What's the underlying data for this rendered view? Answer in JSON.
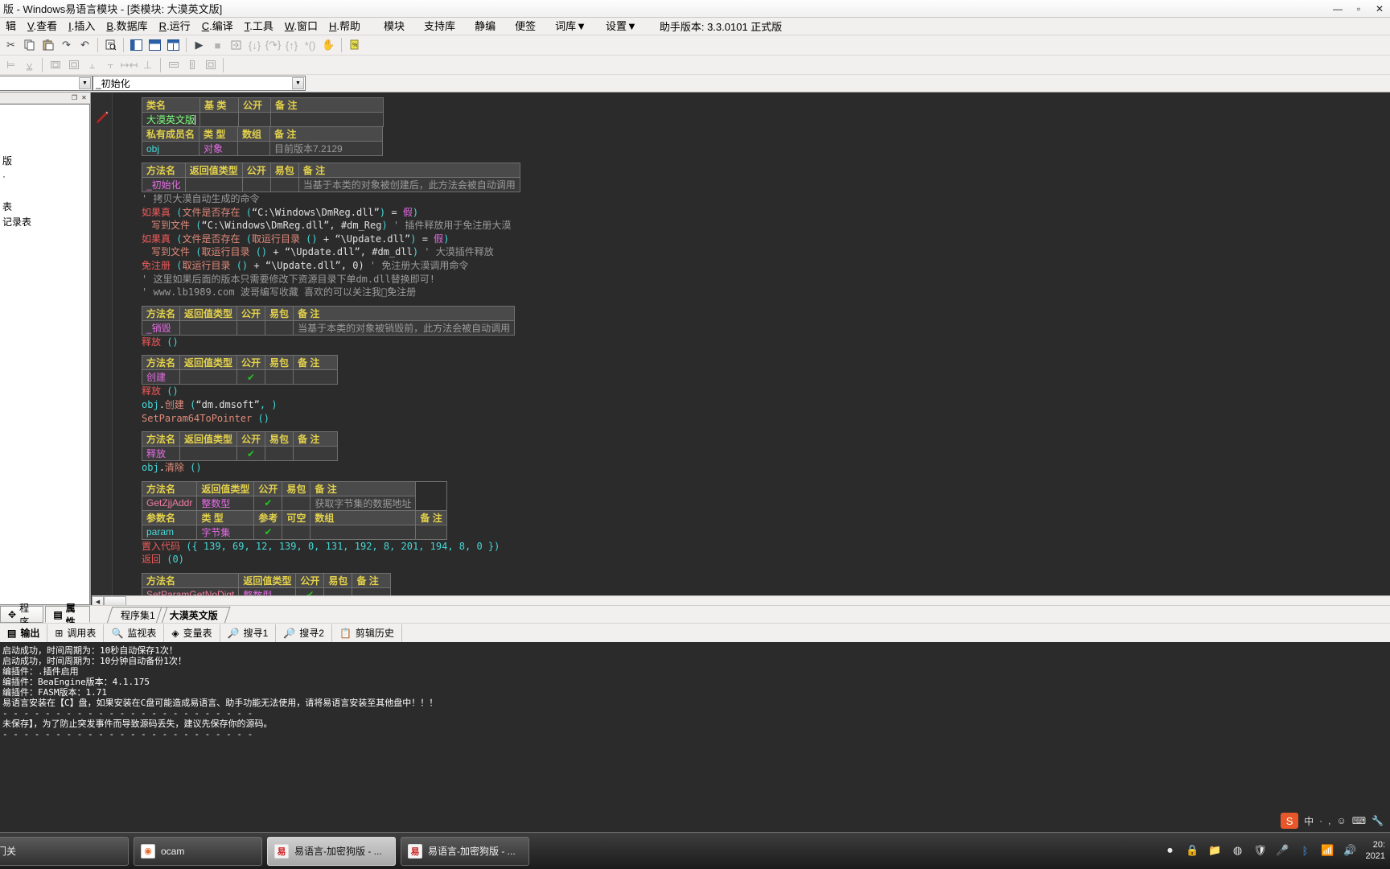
{
  "window": {
    "title": "版 - Windows易语言模块 - [类模块: 大漠英文版]",
    "minimize": "—",
    "maximize": "▫",
    "close": "✕"
  },
  "menubar": {
    "items": [
      {
        "mnemonic": "",
        "label": "辑"
      },
      {
        "mnemonic": "V",
        "label": ".查看"
      },
      {
        "mnemonic": "I",
        "label": ".插入"
      },
      {
        "mnemonic": "B",
        "label": ".数据库"
      },
      {
        "mnemonic": "R",
        "label": ".运行"
      },
      {
        "mnemonic": "C",
        "label": ".编译"
      },
      {
        "mnemonic": "T",
        "label": ".工具"
      },
      {
        "mnemonic": "W",
        "label": ".窗口"
      },
      {
        "mnemonic": "H",
        "label": ".帮助"
      }
    ],
    "extra": [
      "模块",
      "支持库",
      "静编",
      "便签",
      "词库▼",
      "设置▼"
    ],
    "assistant_version": "助手版本: 3.3.0101 正式版"
  },
  "toolbar1": {
    "icons": [
      "cut-icon",
      "copy-icon",
      "paste-icon",
      "redo-icon",
      "undo-icon",
      "find-icon",
      "layout-left-icon",
      "layout-top-icon",
      "layout-grid-icon",
      "run-icon",
      "stop-icon",
      "compile-icon",
      "step-into-icon",
      "step-over-icon",
      "step-out-icon",
      "run-to-cursor-icon",
      "hand-icon",
      "bookmark-icon"
    ]
  },
  "toolbar2": {
    "icons": [
      "align-left-icon",
      "align-center-icon",
      "align-grid-h-icon",
      "align-grid-v-icon",
      "align-top-icon",
      "align-bottom-icon",
      "space-h-icon",
      "space-v-icon",
      "size-width-icon",
      "size-height-icon",
      "size-both-icon"
    ]
  },
  "combos": {
    "left_value": "",
    "right_value": "_初始化"
  },
  "left_panel": {
    "caption_buttons": [
      "restore-icon",
      "close-icon"
    ],
    "lines": [
      "",
      "",
      "",
      "版",
      "·",
      "",
      "表",
      "记录表"
    ]
  },
  "editor": {
    "class_table": {
      "headers": [
        "类名",
        "基 类",
        "公开",
        "备 注"
      ],
      "rows": [
        [
          "大漠英文版",
          "",
          "",
          ""
        ]
      ]
    },
    "member_table": {
      "headers": [
        "私有成员名",
        "类 型",
        "数组",
        "备 注"
      ],
      "rows": [
        [
          "obj",
          "对象",
          "",
          "目前版本7.2129"
        ]
      ]
    },
    "method_init": {
      "headers": [
        "方法名",
        "返回值类型",
        "公开",
        "易包",
        "备 注"
      ],
      "rows": [
        [
          "_初始化",
          "",
          "",
          "",
          "当基于本类的对象被创建后，此方法会被自动调用"
        ]
      ]
    },
    "init_code": [
      {
        "indent": 0,
        "parts": [
          {
            "t": "'  拷贝大漠自动生成的命令",
            "c": "c-gray"
          }
        ]
      },
      {
        "indent": 0,
        "parts": [
          {
            "t": "如果真",
            "c": "c-kw"
          },
          {
            "t": " (",
            "c": "c-cyan"
          },
          {
            "t": "文件是否存在",
            "c": "c-salmon"
          },
          {
            "t": " (",
            "c": "c-cyan"
          },
          {
            "t": "“C:\\Windows\\DmReg.dll”",
            "c": "c-white"
          },
          {
            "t": ")",
            "c": "c-cyan"
          },
          {
            "t": " = ",
            "c": "c-white"
          },
          {
            "t": "假",
            "c": "c-magenta"
          },
          {
            "t": ")",
            "c": "c-cyan"
          }
        ]
      },
      {
        "indent": 1,
        "parts": [
          {
            "t": "写到文件",
            "c": "c-salmon"
          },
          {
            "t": " (",
            "c": "c-cyan"
          },
          {
            "t": "“C:\\Windows\\DmReg.dll”",
            "c": "c-white"
          },
          {
            "t": ", ",
            "c": "c-white"
          },
          {
            "t": "#dm_Reg",
            "c": "c-white"
          },
          {
            "t": ")",
            "c": "c-cyan"
          },
          {
            "t": "   '  插件释放用于免注册大漠",
            "c": "c-gray"
          }
        ]
      },
      {
        "indent": 0,
        "parts": [
          {
            "t": "如果真",
            "c": "c-kw"
          },
          {
            "t": " (",
            "c": "c-cyan"
          },
          {
            "t": "文件是否存在",
            "c": "c-salmon"
          },
          {
            "t": " (",
            "c": "c-cyan"
          },
          {
            "t": "取运行目录",
            "c": "c-salmon"
          },
          {
            "t": " ()",
            "c": "c-cyan"
          },
          {
            "t": " + ",
            "c": "c-white"
          },
          {
            "t": "“\\Update.dll”",
            "c": "c-white"
          },
          {
            "t": ")",
            "c": "c-cyan"
          },
          {
            "t": " = ",
            "c": "c-white"
          },
          {
            "t": "假",
            "c": "c-magenta"
          },
          {
            "t": ")",
            "c": "c-cyan"
          }
        ]
      },
      {
        "indent": 1,
        "parts": [
          {
            "t": "写到文件",
            "c": "c-salmon"
          },
          {
            "t": " (",
            "c": "c-cyan"
          },
          {
            "t": "取运行目录",
            "c": "c-salmon"
          },
          {
            "t": " ()",
            "c": "c-cyan"
          },
          {
            "t": " + ",
            "c": "c-white"
          },
          {
            "t": "“\\Update.dll”",
            "c": "c-white"
          },
          {
            "t": ", ",
            "c": "c-white"
          },
          {
            "t": "#dm_dll",
            "c": "c-white"
          },
          {
            "t": ")",
            "c": "c-cyan"
          },
          {
            "t": "   '  大漠插件释放",
            "c": "c-gray"
          }
        ]
      },
      {
        "indent": 0,
        "parts": [
          {
            "t": "免注册",
            "c": "c-kw"
          },
          {
            "t": " (",
            "c": "c-cyan"
          },
          {
            "t": "取运行目录",
            "c": "c-salmon"
          },
          {
            "t": " ()",
            "c": "c-cyan"
          },
          {
            "t": " + ",
            "c": "c-white"
          },
          {
            "t": "“\\Update.dll”",
            "c": "c-white"
          },
          {
            "t": ", 0)",
            "c": "c-white"
          },
          {
            "t": "   '  免注册大漠调用命令",
            "c": "c-gray"
          }
        ]
      },
      {
        "indent": 0,
        "parts": [
          {
            "t": "'  这里如果后面的版本只需要修改下资源目录下单dm.dll替换即可!",
            "c": "c-gray"
          }
        ]
      },
      {
        "indent": 0,
        "parts": [
          {
            "t": "'  www.lb1989.com 波哥编写收藏 喜欢的可以关注我哟̈免注册",
            "c": "c-gray"
          }
        ]
      }
    ],
    "method_destroy": {
      "headers": [
        "方法名",
        "返回值类型",
        "公开",
        "易包",
        "备 注"
      ],
      "rows": [
        [
          "_销毁",
          "",
          "",
          "",
          "当基于本类的对象被销毁前，此方法会被自动调用"
        ]
      ]
    },
    "destroy_code": [
      {
        "t": "释放",
        "c": "c-kw"
      },
      {
        "t": " ()",
        "c": "c-cyan"
      }
    ],
    "method_create": {
      "headers": [
        "方法名",
        "返回值类型",
        "公开",
        "易包",
        "备 注"
      ],
      "rows": [
        [
          "创建",
          "",
          "✔",
          "",
          ""
        ]
      ]
    },
    "create_code": [
      [
        {
          "t": "释放",
          "c": "c-kw"
        },
        {
          "t": " ()",
          "c": "c-cyan"
        }
      ],
      [
        {
          "t": "obj",
          "c": "c-cyan"
        },
        {
          "t": ".",
          "c": "c-white"
        },
        {
          "t": "创建",
          "c": "c-salmon"
        },
        {
          "t": " (",
          "c": "c-cyan"
        },
        {
          "t": "“dm.dmsoft”",
          "c": "c-white"
        },
        {
          "t": ", )",
          "c": "c-cyan"
        }
      ],
      [
        {
          "t": "SetParam64ToPointer",
          "c": "c-salmon"
        },
        {
          "t": " ()",
          "c": "c-cyan"
        }
      ]
    ],
    "method_release": {
      "headers": [
        "方法名",
        "返回值类型",
        "公开",
        "易包",
        "备 注"
      ],
      "rows": [
        [
          "释放",
          "",
          "✔",
          "",
          ""
        ]
      ]
    },
    "release_code": [
      [
        {
          "t": "obj",
          "c": "c-cyan"
        },
        {
          "t": ".",
          "c": "c-white"
        },
        {
          "t": "清除",
          "c": "c-salmon"
        },
        {
          "t": " ()",
          "c": "c-cyan"
        }
      ]
    ],
    "method_getzjj": {
      "headers": [
        "方法名",
        "返回值类型",
        "公开",
        "易包",
        "备 注"
      ],
      "rows": [
        [
          "GetZjjAddr",
          "整数型",
          "✔",
          "",
          "获取字节集的数据地址"
        ]
      ],
      "param_headers": [
        "参数名",
        "类 型",
        "参考",
        "可空",
        "数组",
        "备 注"
      ],
      "param_rows": [
        [
          "param",
          "字节集",
          "✔",
          "",
          "",
          ""
        ]
      ]
    },
    "getzjj_code": [
      [
        {
          "t": "置入代码",
          "c": "c-kw"
        },
        {
          "t": " ({ 139, 69, 12, 139, 0, 131, 192, 8, 201, 194, 8, 0 })",
          "c": "c-cyan"
        }
      ],
      [
        {
          "t": "返回",
          "c": "c-kw"
        },
        {
          "t": " (0)",
          "c": "c-cyan"
        }
      ]
    ],
    "method_last": {
      "headers": [
        "方法名",
        "返回值类型",
        "公开",
        "易包",
        "备 注"
      ],
      "rows": [
        [
          "SetParamGetNoDigt",
          "整数型",
          "✔",
          "",
          ""
        ]
      ]
    }
  },
  "bottom_tabs": {
    "panel_tabs": [
      {
        "icon": "program-icon",
        "label": "程序"
      },
      {
        "icon": "properties-icon",
        "label": "属性"
      }
    ],
    "sheet_tabs": [
      {
        "label": "程序集1",
        "active": false
      },
      {
        "label": "大漠英文版",
        "active": true
      }
    ]
  },
  "output_toolbar": {
    "buttons": [
      {
        "icon": "output-icon",
        "label": "输出"
      },
      {
        "icon": "calltable-icon",
        "label": "调用表"
      },
      {
        "icon": "watch-icon",
        "label": "监视表"
      },
      {
        "icon": "variable-icon",
        "label": "变量表"
      },
      {
        "icon": "search1-icon",
        "label": "搜寻1"
      },
      {
        "icon": "search2-icon",
        "label": "搜寻2"
      },
      {
        "icon": "clipboard-history-icon",
        "label": "剪辑历史"
      }
    ]
  },
  "console": {
    "lines": [
      "启动成功，时间周期为：10秒自动保存1次！",
      "启动成功，时间周期为：10分钟自动备份1次！",
      "编插件：.插件启用",
      "编插件：BeaEngine版本：4.1.175",
      "编插件：FASM版本：1.71",
      "易语言安装在【C】盘，如果安装在C盘可能造成易语言、助手功能无法使用，请将易语言安装至其他盘中！！！",
      "- - - - - - - - - - - - - - - - - - - - - - - -",
      "未保存】，为了防止突发事件而导致源码丢失，建议先保存你的源码。",
      "- - - - - - - - - - - - - - - - - - - - - - - -"
    ]
  },
  "ime": {
    "logo": "S",
    "items": [
      "中",
      "·",
      ",",
      "☺",
      "⌨",
      "🔧"
    ]
  },
  "taskbar": {
    "items": [
      {
        "icon": "window-icon",
        "label": "入门关",
        "active": false
      },
      {
        "icon": "ocam-icon",
        "label": "ocam",
        "active": false
      },
      {
        "icon": "eyuyan-icon",
        "label": "易语言-加密狗版 - ...",
        "active": true
      },
      {
        "icon": "eyuyan-icon",
        "label": "易语言-加密狗版 - ...",
        "active": false
      }
    ],
    "tray_icons": [
      "record-icon",
      "lock-icon",
      "folder-icon",
      "chrome-icon",
      "shield-icon",
      "mic-icon",
      "bluetooth-icon",
      "network-icon",
      "volume-icon"
    ],
    "clock_time": "20:",
    "clock_date": "2021"
  }
}
